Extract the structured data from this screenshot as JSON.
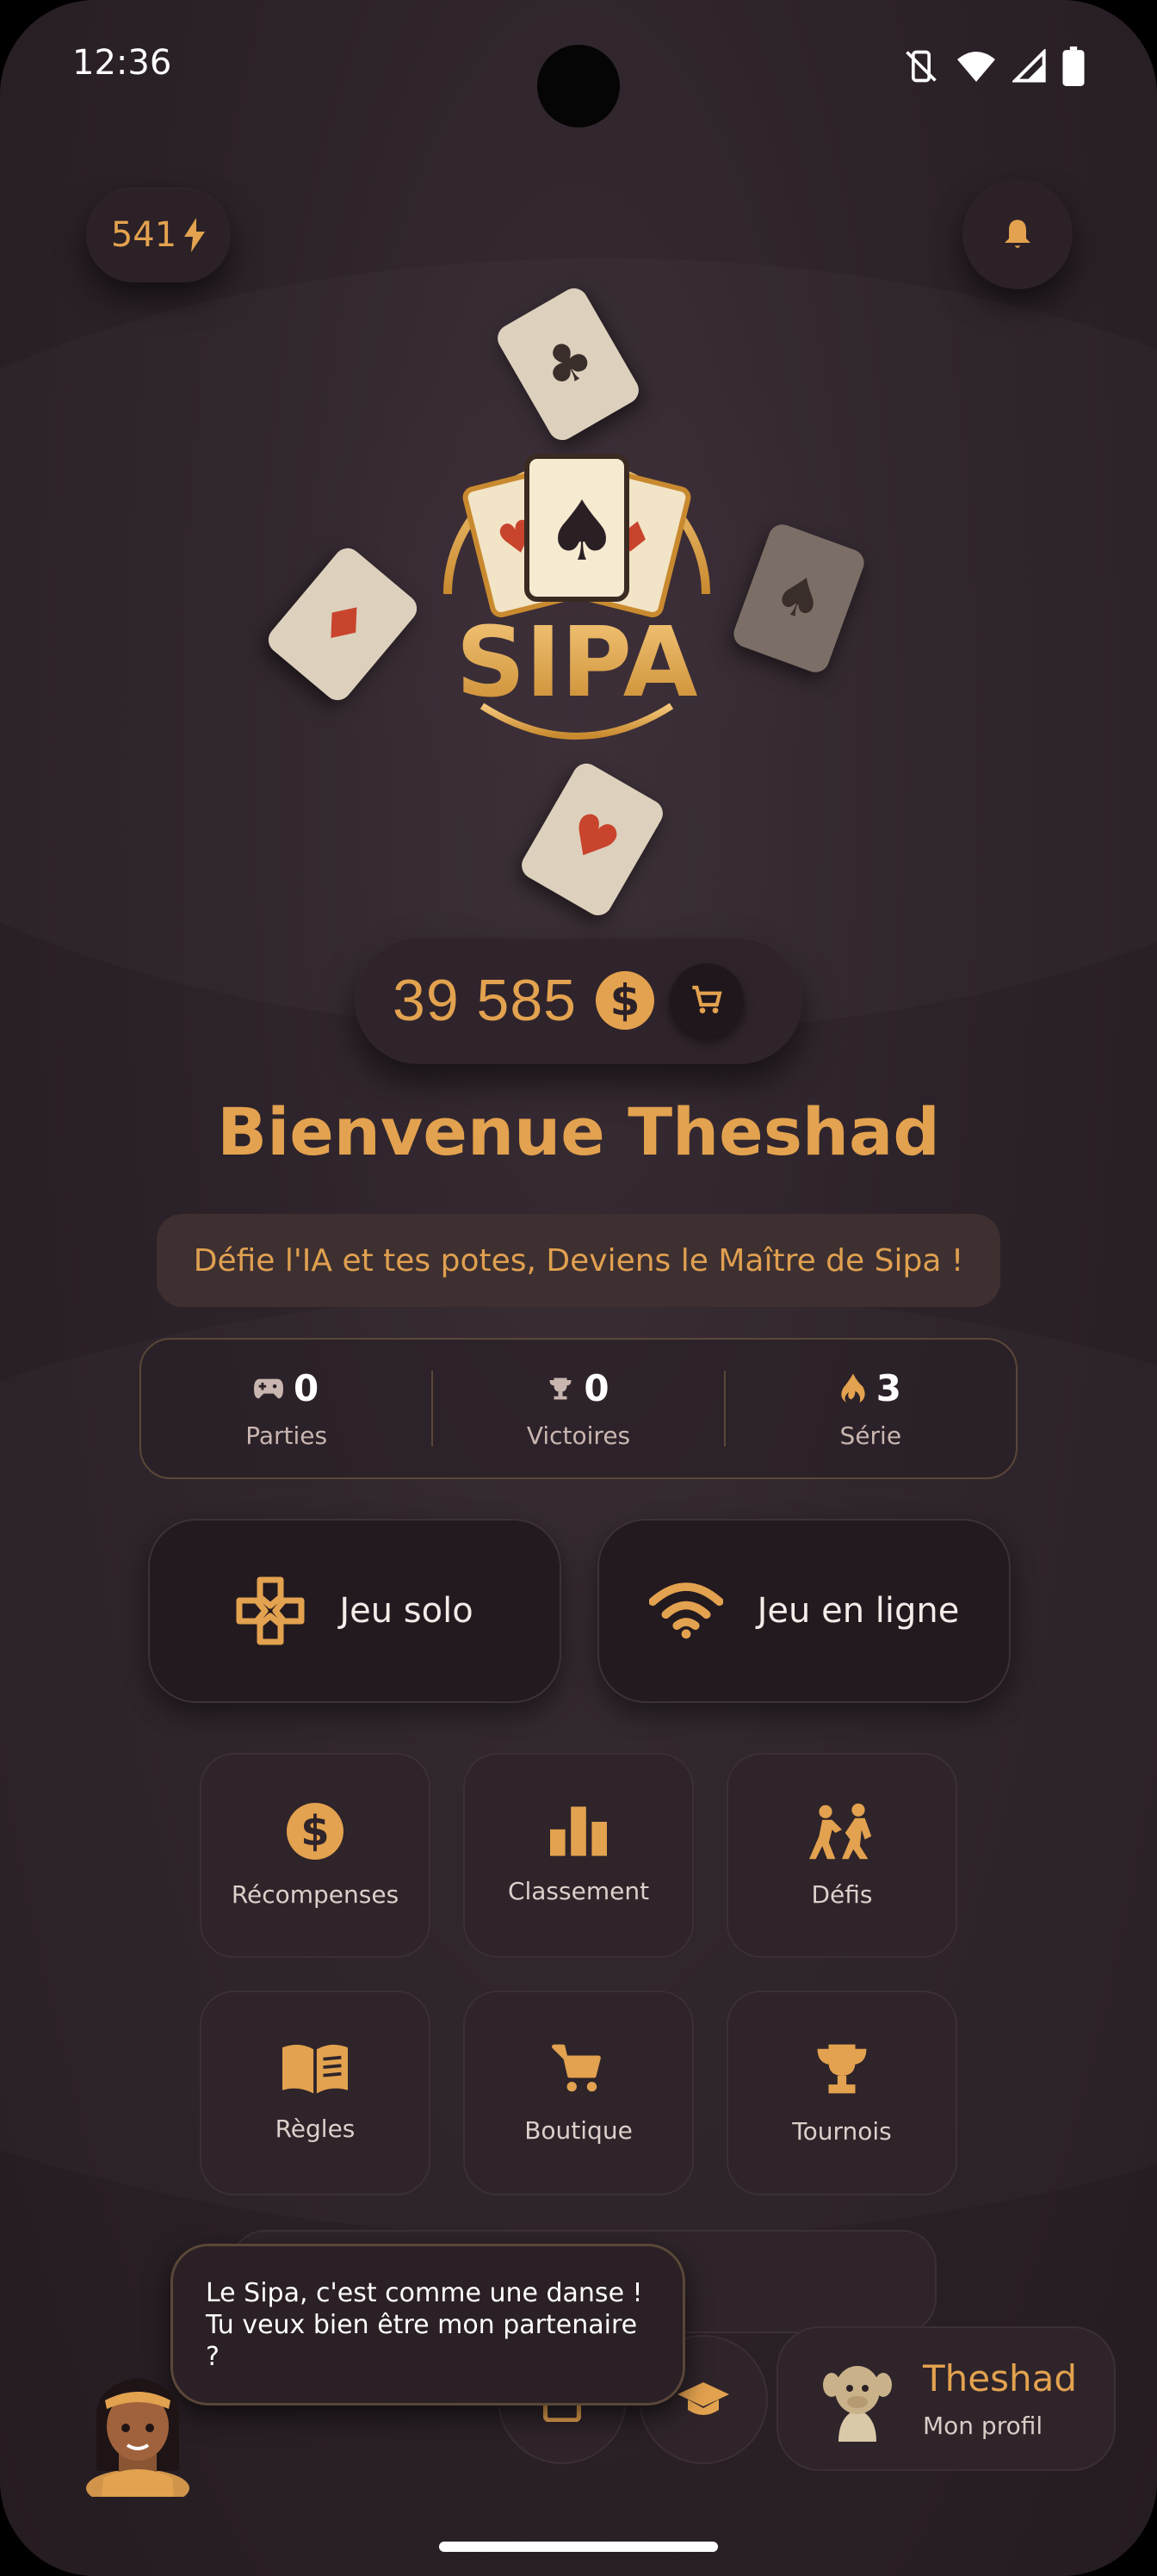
{
  "status_bar": {
    "time": "12:36"
  },
  "energy": {
    "value": "541"
  },
  "logo": {
    "text": "SIPA"
  },
  "wallet": {
    "coins": "39 585"
  },
  "welcome": "Bienvenue Theshad",
  "tagline": "Défie l'IA et tes potes,  Deviens le Maître de Sipa !",
  "stats": [
    {
      "value": "0",
      "label": "Parties",
      "icon": "gamepad-icon"
    },
    {
      "value": "0",
      "label": "Victoires",
      "icon": "trophy-icon"
    },
    {
      "value": "3",
      "label": "Série",
      "icon": "flame-icon"
    }
  ],
  "modes": {
    "solo": "Jeu solo",
    "online": "Jeu en ligne"
  },
  "menu": [
    {
      "label": "Récompenses",
      "icon": "dollar-icon"
    },
    {
      "label": "Classement",
      "icon": "bar-chart-icon"
    },
    {
      "label": "Défis",
      "icon": "fight-icon"
    },
    {
      "label": "Règles",
      "icon": "book-icon"
    },
    {
      "label": "Boutique",
      "icon": "cart-icon"
    },
    {
      "label": "Tournois",
      "icon": "trophy-icon"
    }
  ],
  "mascot_bubble": "Le Sipa, c'est comme une danse ! Tu veux bien être mon partenaire ?",
  "profile": {
    "name": "Theshad",
    "subtitle": "Mon profil"
  },
  "colors": {
    "accent": "#e3a24f",
    "background": "#2c2229",
    "card": "#2e242a"
  }
}
